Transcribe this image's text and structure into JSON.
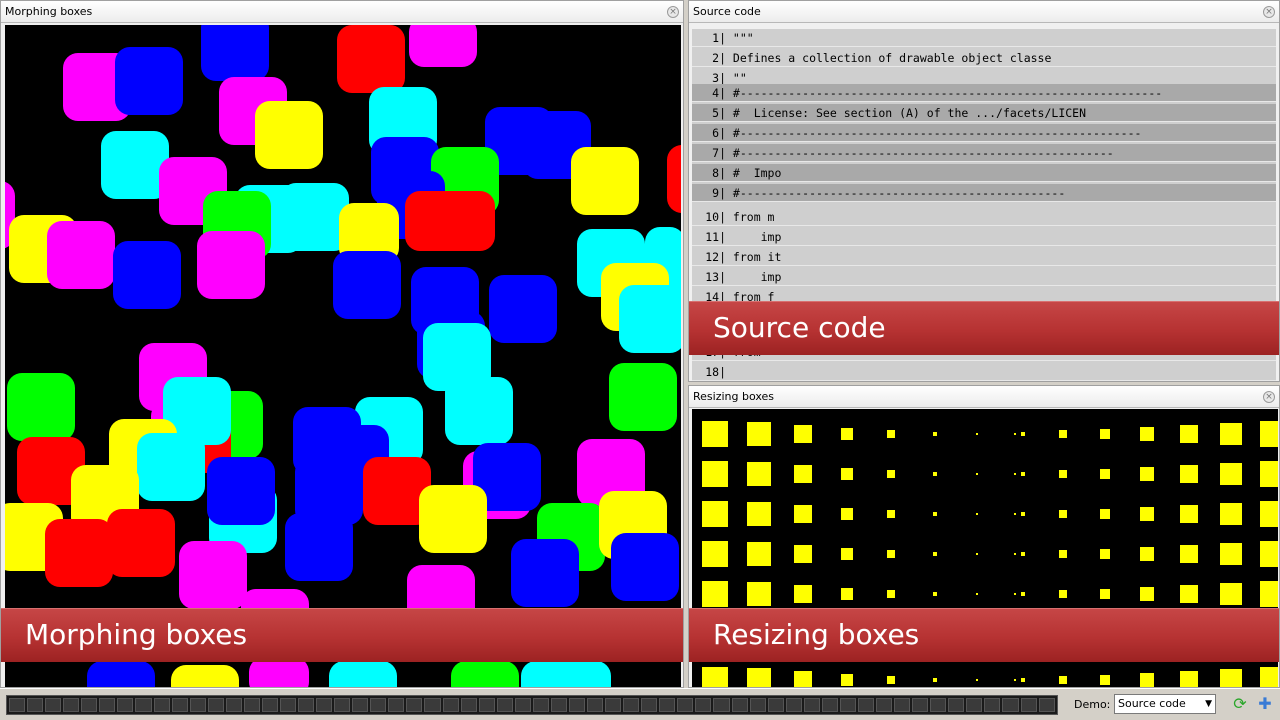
{
  "panels": {
    "morphing": {
      "title": "Morphing boxes",
      "banner": "Morphing boxes"
    },
    "source": {
      "title": "Source code",
      "banner": "Source code"
    },
    "resizing": {
      "title": "Resizing boxes",
      "banner": "Resizing boxes"
    }
  },
  "close_glyph": "×",
  "code_lines": [
    {
      "n": "1|",
      "text": "\"\"\"",
      "dark": false
    },
    {
      "n": "2|",
      "text": "Defines a collection of drawable object classe",
      "dark": false
    },
    {
      "n": "3|",
      "text": "\"\"",
      "dark": false
    },
    {
      "n": "4|",
      "text": "#-------------------------------------------------------------",
      "dark": true
    },
    {
      "n": "5|",
      "text": "#  License: See section (A) of the .../facets/LICEN",
      "dark": true
    },
    {
      "n": "6|",
      "text": "#----------------------------------------------------------",
      "dark": true
    },
    {
      "n": "7|",
      "text": "#------------------------------------------------------",
      "dark": true
    },
    {
      "n": "8|",
      "text": "#  Impo",
      "dark": true
    },
    {
      "n": "9|",
      "text": "#-----------------------------------------------",
      "dark": true
    },
    {
      "n": "10|",
      "text": "from m",
      "dark": false
    },
    {
      "n": "11|",
      "text": "    imp",
      "dark": false
    },
    {
      "n": "12|",
      "text": "from it",
      "dark": false
    },
    {
      "n": "13|",
      "text": "    imp",
      "dark": false
    },
    {
      "n": "14|",
      "text": "from f",
      "dark": false
    },
    {
      "n": "17|",
      "text": "from",
      "dark": false
    },
    {
      "n": "18|",
      "text": "",
      "dark": false
    }
  ],
  "statusbar": {
    "demo_label": "Demo:",
    "demo_value": "Source code",
    "dropdown_arrow": "▼",
    "refresh_glyph": "⟳",
    "add_glyph": "✚"
  },
  "colors": {
    "magenta": "#ff00ff",
    "blue": "#0000ff",
    "cyan": "#00ffff",
    "yellow": "#ffff00",
    "red": "#ff0000",
    "green": "#00ff00",
    "banner": "#b83333"
  }
}
